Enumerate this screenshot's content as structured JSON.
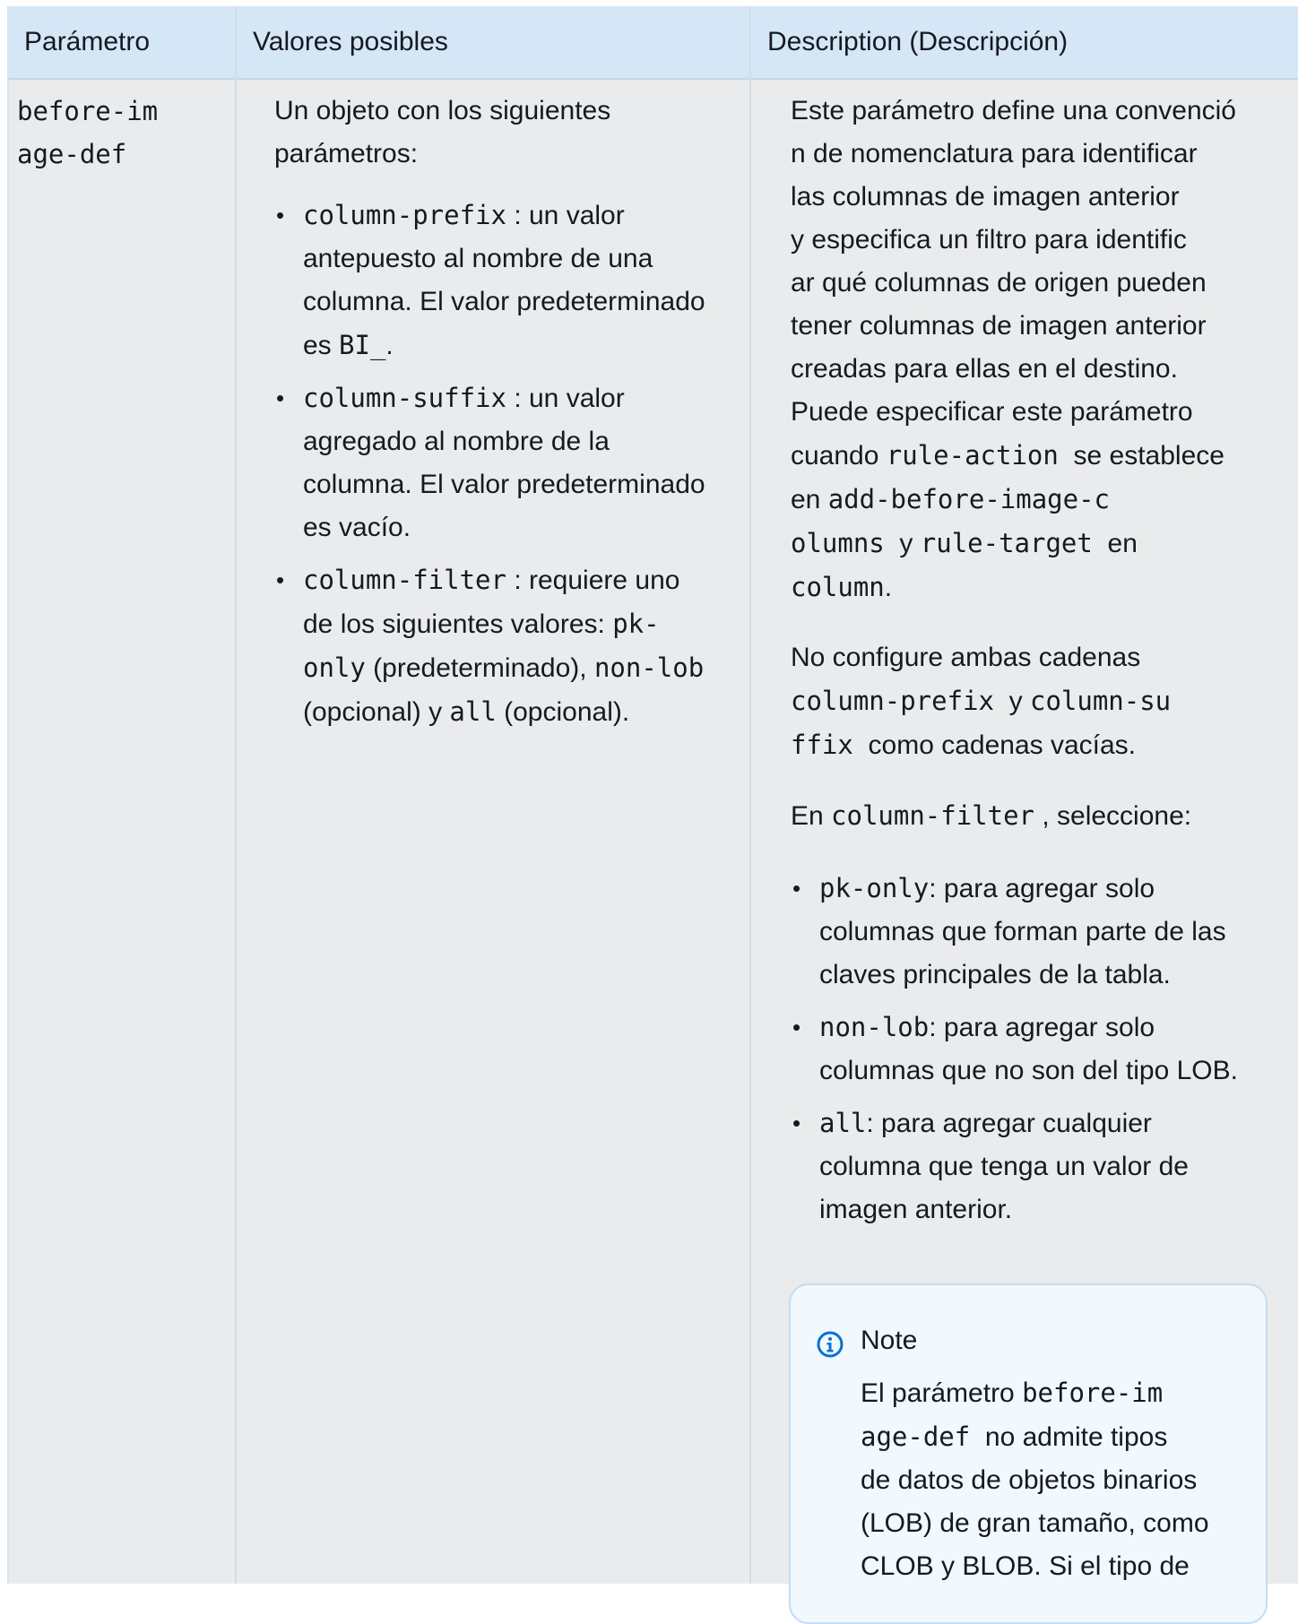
{
  "header": {
    "col1": "Parámetro",
    "col2": "Valores posibles",
    "col3": "Description (Descripción)"
  },
  "row": {
    "param_line1": "before-im",
    "param_line2": "age-def",
    "values_intro_l1": "Un objeto con los siguientes",
    "values_intro_l2": "parámetros:",
    "values_items": [
      {
        "code": "column-prefix",
        "l1_rest": " : un valor",
        "l2": "antepuesto al nombre de una",
        "l3": "columna. El valor predeterminado",
        "l4_pre": "es ",
        "l4_code": "BI_",
        "l4_post": "."
      },
      {
        "code": "column-suffix",
        "l1_rest": " : un valor",
        "l2": "agregado al nombre de la",
        "l3": "columna. El valor predeterminado",
        "l4": "es vacío."
      },
      {
        "code": "column-filter",
        "l1_rest": " : requiere uno",
        "l2_pre": "de los siguientes valores: ",
        "l2_code": "pk-",
        "l3_code": "only",
        "l3_mid": " (predeterminado), ",
        "l3_code2": "non-lob",
        "l4_pre": "(opcional) y ",
        "l4_code": "all",
        "l4_post": " (opcional)."
      }
    ],
    "desc": {
      "p1_l1": "Este parámetro define una convenció",
      "p1_l2": "n de nomenclatura para identificar",
      "p1_l3": "las columnas de imagen anterior",
      "p1_l4": "y especifica un filtro para identific",
      "p1_l5": "ar qué columnas de origen pueden",
      "p1_l6": "tener columnas de imagen anterior",
      "p1_l7": "creadas para ellas en el destino.",
      "p1_l8": "Puede especificar este parámetro",
      "p1_l9_pre": "cuando ",
      "p1_l9_code": "rule-action",
      "p1_l9_post": "  se establece",
      "p1_l10_pre": "en ",
      "p1_l10_code": "add-before-image-c",
      "p1_l11_code": "olumns",
      "p1_l11_mid": "  y ",
      "p1_l11_code2": "rule-target",
      "p1_l11_post": "  en",
      "p1_l12_code": "column",
      "p1_l12_post": ".",
      "p2_l1": "No configure ambas cadenas",
      "p2_l2_code": "column-prefix",
      "p2_l2_mid": "  y ",
      "p2_l2_code2": "column-su",
      "p2_l3_code": "ffix",
      "p2_l3_post": "  como cadenas vacías.",
      "p3_pre": "En ",
      "p3_code": "column-filter",
      "p3_post": " , seleccione:",
      "items": [
        {
          "code": "pk-only",
          "l1_rest": ": para agregar solo",
          "l2": "columnas que forman parte de las",
          "l3": "claves principales de la tabla."
        },
        {
          "code": "non-lob",
          "l1_rest": ": para agregar solo",
          "l2": "columnas que no son del tipo LOB."
        },
        {
          "code": "all",
          "l1_rest": ": para agregar cualquier",
          "l2": "columna que tenga un valor de",
          "l3": "imagen anterior."
        }
      ]
    },
    "note": {
      "title": "Note",
      "l1_pre": "El parámetro ",
      "l1_code": "before-im",
      "l2_code": "age-def",
      "l2_post": "  no admite tipos",
      "l3": "de datos de objetos binarios",
      "l4": "(LOB) de gran tamaño, como",
      "l5": "CLOB y BLOB. Si el tipo de",
      "icon": "info-icon"
    }
  },
  "colors": {
    "header_bg": "#d5e6f7",
    "body_bg": "#eaebec",
    "note_bg": "#f1f8fe",
    "note_icon": "#0972d3"
  }
}
